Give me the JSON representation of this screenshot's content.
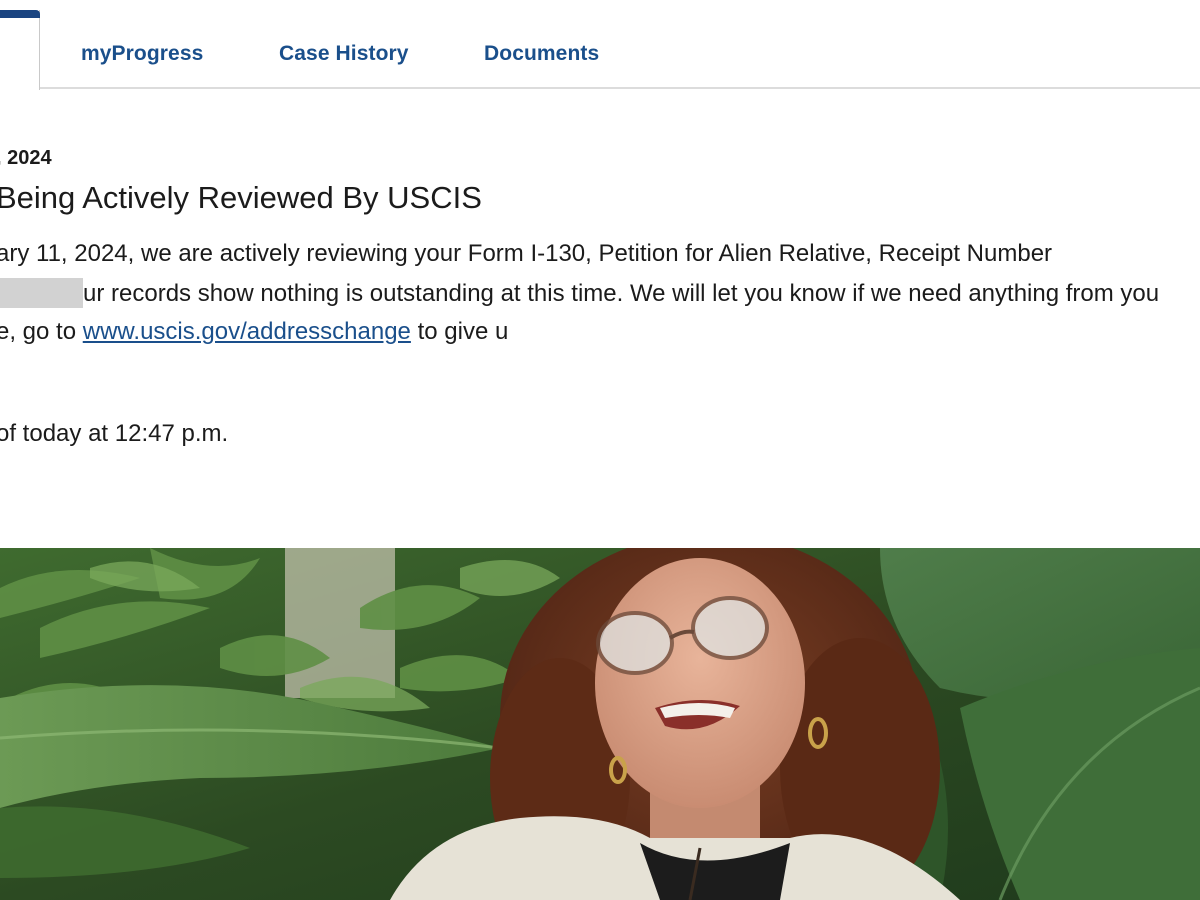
{
  "tabs": {
    "items": [
      {
        "label": "myProgress"
      },
      {
        "label": "Case History"
      },
      {
        "label": "Documents"
      }
    ],
    "accent_color": "#1a4480",
    "link_color": "#1a4f8b"
  },
  "case_status": {
    "date_fragment": ", 2024",
    "title_fragment": "Being Actively Reviewed By USCIS",
    "line1": "ary 11, 2024, we are actively reviewing your Form I-130, Petition for Alien Relative, Receipt Number",
    "line2_after_redaction": "ur records show nothing is outstanding at this time. We will let you know if we need anything from you",
    "line3_prefix": "e, go to ",
    "line3_link": "www.uscis.gov/addresschange",
    "line3_suffix": " to give u",
    "updated_fragment": "of today at 12:47 p.m."
  },
  "photo": {
    "description_icon": "portrait-photo-icon"
  }
}
